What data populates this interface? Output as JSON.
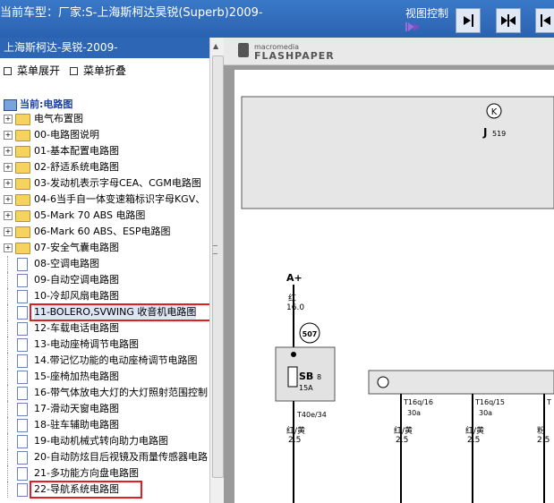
{
  "topbar": {
    "title": "当前车型：厂家:S-上海斯柯达昊锐(Superb)2009-",
    "view_control": "视图控制"
  },
  "left_panel": {
    "header": "上海斯柯达-昊锐-2009-",
    "expand_menu": "菜单展开",
    "collapse_menu": "菜单折叠",
    "current": "当前:电路图",
    "items": [
      {
        "label": "电气布置图",
        "type": "folder"
      },
      {
        "label": "00-电路图说明",
        "type": "folder"
      },
      {
        "label": "01-基本配置电路图",
        "type": "folder"
      },
      {
        "label": "02-舒适系统电路图",
        "type": "folder"
      },
      {
        "label": "03-发动机表示字母CEA、CGM电路图",
        "type": "folder"
      },
      {
        "label": "04-6当手自一体变速箱标识字母KGV、",
        "type": "folder"
      },
      {
        "label": "05-Mark 70 ABS 电路图",
        "type": "folder"
      },
      {
        "label": "06-Mark 60 ABS、ESP电路图",
        "type": "folder"
      },
      {
        "label": "07-安全气囊电路图",
        "type": "folder"
      },
      {
        "label": "08-空调电路图",
        "type": "doc"
      },
      {
        "label": "09-自动空调电路图",
        "type": "doc"
      },
      {
        "label": "10-冷却风扇电路图",
        "type": "doc"
      },
      {
        "label": "11-BOLERO,SVWING 收音机电路图",
        "type": "doc"
      },
      {
        "label": "12-车载电话电路图",
        "type": "doc"
      },
      {
        "label": "13-电动座椅调节电路图",
        "type": "doc"
      },
      {
        "label": "14.带记忆功能的电动座椅调节电路图",
        "type": "doc"
      },
      {
        "label": "15-座椅加热电路图",
        "type": "doc"
      },
      {
        "label": "16-带气体放电大灯的大灯照射范围控制",
        "type": "doc"
      },
      {
        "label": "17-滑动天窗电路图",
        "type": "doc"
      },
      {
        "label": "18-驻车辅助电路图",
        "type": "doc"
      },
      {
        "label": "19-电动机械式转向助力电路图",
        "type": "doc"
      },
      {
        "label": "20-自动防炫目后视镜及雨量传感器电路",
        "type": "doc"
      },
      {
        "label": "21-多功能方向盘电路图",
        "type": "doc"
      },
      {
        "label": "22-导航系统电路图",
        "type": "doc"
      }
    ]
  },
  "viewer": {
    "brand_small": "macromedia",
    "brand_big": "FLASHPAPER",
    "diagram": {
      "k_symbol": "K",
      "j_label": "J",
      "j_sub": "519",
      "a_plus": "A+",
      "wire1_color": "红",
      "wire1_size": "16.0",
      "connector": "507",
      "fuse_label": "SB",
      "fuse_num": "8",
      "fuse_amp": "15A",
      "t40": "T40e/34",
      "w_left_color": "红/黄",
      "w_left_size": "2.5",
      "t16a": "T16q/16",
      "t16a_amp": "30a",
      "t16b": "T16q/15",
      "t16b_amp": "30a",
      "t16c": "T",
      "w2_color": "红/黄",
      "w2_size": "2.5",
      "w3_color": "红/黄",
      "w3_size": "2.5",
      "w4_color": "粉",
      "w4_size": "2.5"
    }
  }
}
